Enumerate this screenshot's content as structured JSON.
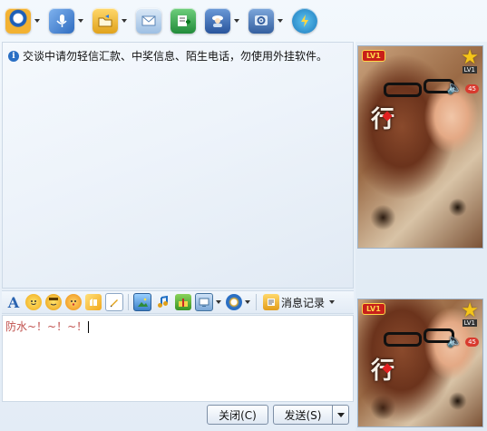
{
  "toolbar": {
    "items": [
      {
        "name": "webcam",
        "color": "#f0a020",
        "glyph": "●"
      },
      {
        "name": "microphone",
        "color": "#3a7bd5",
        "glyph": "🎤"
      },
      {
        "name": "folder",
        "color": "#e3b341",
        "glyph": "▤"
      },
      {
        "name": "email",
        "color": "#7fb0dd",
        "glyph": "✉"
      },
      {
        "name": "add-note",
        "color": "#2f9a4a",
        "glyph": "+"
      },
      {
        "name": "user-card",
        "color": "#3b6db3",
        "glyph": "☺"
      },
      {
        "name": "settings",
        "color": "#4b79b6",
        "glyph": "⚙"
      },
      {
        "name": "share",
        "color": "#2ba0d8",
        "glyph": "⚡"
      }
    ]
  },
  "history": {
    "notice": "交谈中请勿轻信汇款、中奖信息、陌生电话，勿使用外挂软件。"
  },
  "format_toolbar": {
    "font_glyph": "A",
    "history_label": "消息记录"
  },
  "input": {
    "text": "防水~！~！~！"
  },
  "buttons": {
    "close_label": "关闭(C)",
    "send_label": "发送(S)"
  },
  "video_top": {
    "level": "LV1",
    "star_level": "LV1",
    "count": "45",
    "char": "行"
  },
  "video_bottom": {
    "level": "LV1",
    "star_level": "LV1",
    "count": "45",
    "char": "行"
  }
}
